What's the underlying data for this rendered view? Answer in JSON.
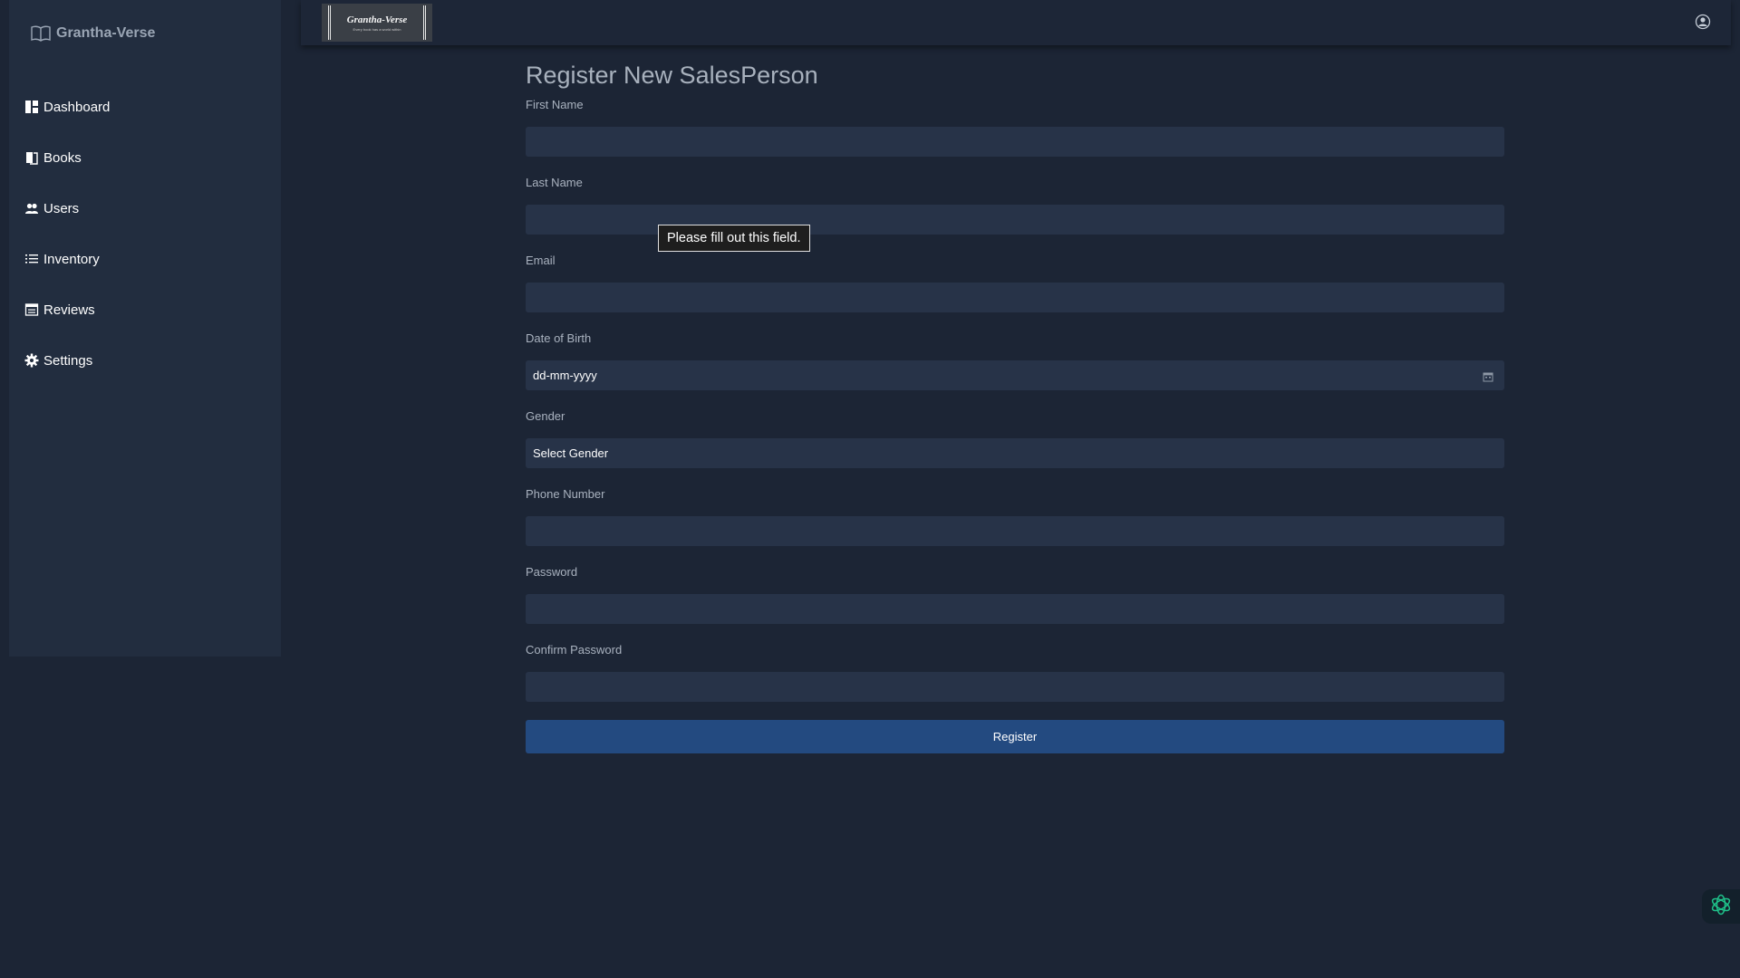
{
  "brand": {
    "name": "Grantha-Verse",
    "icon": "book-open-icon"
  },
  "sidebar": {
    "items": [
      {
        "label": "Dashboard",
        "icon": "dashboard-icon"
      },
      {
        "label": "Books",
        "icon": "book-icon"
      },
      {
        "label": "Users",
        "icon": "users-icon"
      },
      {
        "label": "Inventory",
        "icon": "list-icon"
      },
      {
        "label": "Reviews",
        "icon": "reviews-icon"
      },
      {
        "label": "Settings",
        "icon": "gear-icon"
      }
    ]
  },
  "header": {
    "logo_title": "Grantha-Verse",
    "logo_tagline": "Every book has a world within",
    "profile_icon": "user-circle-icon"
  },
  "form": {
    "title": "Register New SalesPerson",
    "first_name_label": "First Name",
    "last_name_label": "Last Name",
    "email_label": "Email",
    "dob_label": "Date of Birth",
    "dob_placeholder": "dd-mm-yyyy",
    "gender_label": "Gender",
    "gender_selected": "Select Gender",
    "phone_label": "Phone Number",
    "password_label": "Password",
    "confirm_password_label": "Confirm Password",
    "submit_label": "Register"
  },
  "validation_tooltip": "Please fill out this field.",
  "colors": {
    "background": "#1c2535",
    "sidebar": "#222d3f",
    "input": "#273348",
    "primary_button": "#234a80",
    "assistant_icon": "#1fc28a"
  }
}
